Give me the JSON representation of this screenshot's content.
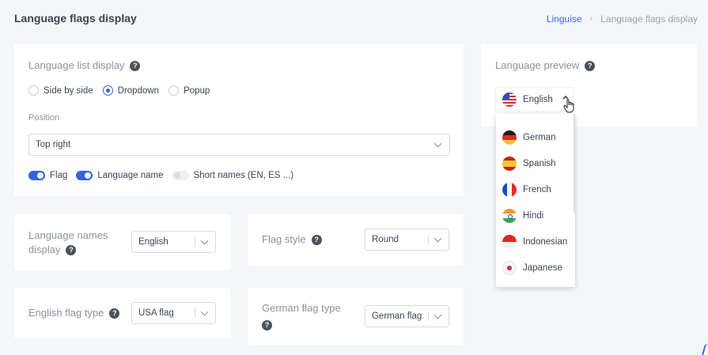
{
  "header": {
    "title": "Language flags display"
  },
  "breadcrumb": {
    "root": "Linguise",
    "separator": "›",
    "current": "Language flags display"
  },
  "list_display": {
    "label": "Language list display",
    "help": "?",
    "options": [
      "Side by side",
      "Dropdown",
      "Popup"
    ],
    "selected": "Dropdown",
    "position_label": "Position",
    "position_value": "Top right",
    "toggles": [
      {
        "label": "Flag",
        "on": true
      },
      {
        "label": "Language name",
        "on": true
      },
      {
        "label": "Short names (EN, ES ...)",
        "on": false
      }
    ]
  },
  "language_names": {
    "label_line1": "Language names",
    "label_line2": "display",
    "help": "?",
    "value": "English"
  },
  "flag_style": {
    "label": "Flag style",
    "help": "?",
    "value": "Round"
  },
  "english_flag": {
    "label": "English flag type",
    "help": "?",
    "value": "USA flag"
  },
  "german_flag": {
    "label": "German flag type",
    "help": "?",
    "value": "German flag"
  },
  "preview": {
    "label": "Language preview",
    "help": "?",
    "current": "English",
    "languages": [
      "German",
      "Spanish",
      "French",
      "Hindi",
      "Indonesian",
      "Japanese"
    ]
  },
  "colors": {
    "accent": "#3461e0",
    "link": "#3c6ad8",
    "background": "#f5f6fa"
  }
}
